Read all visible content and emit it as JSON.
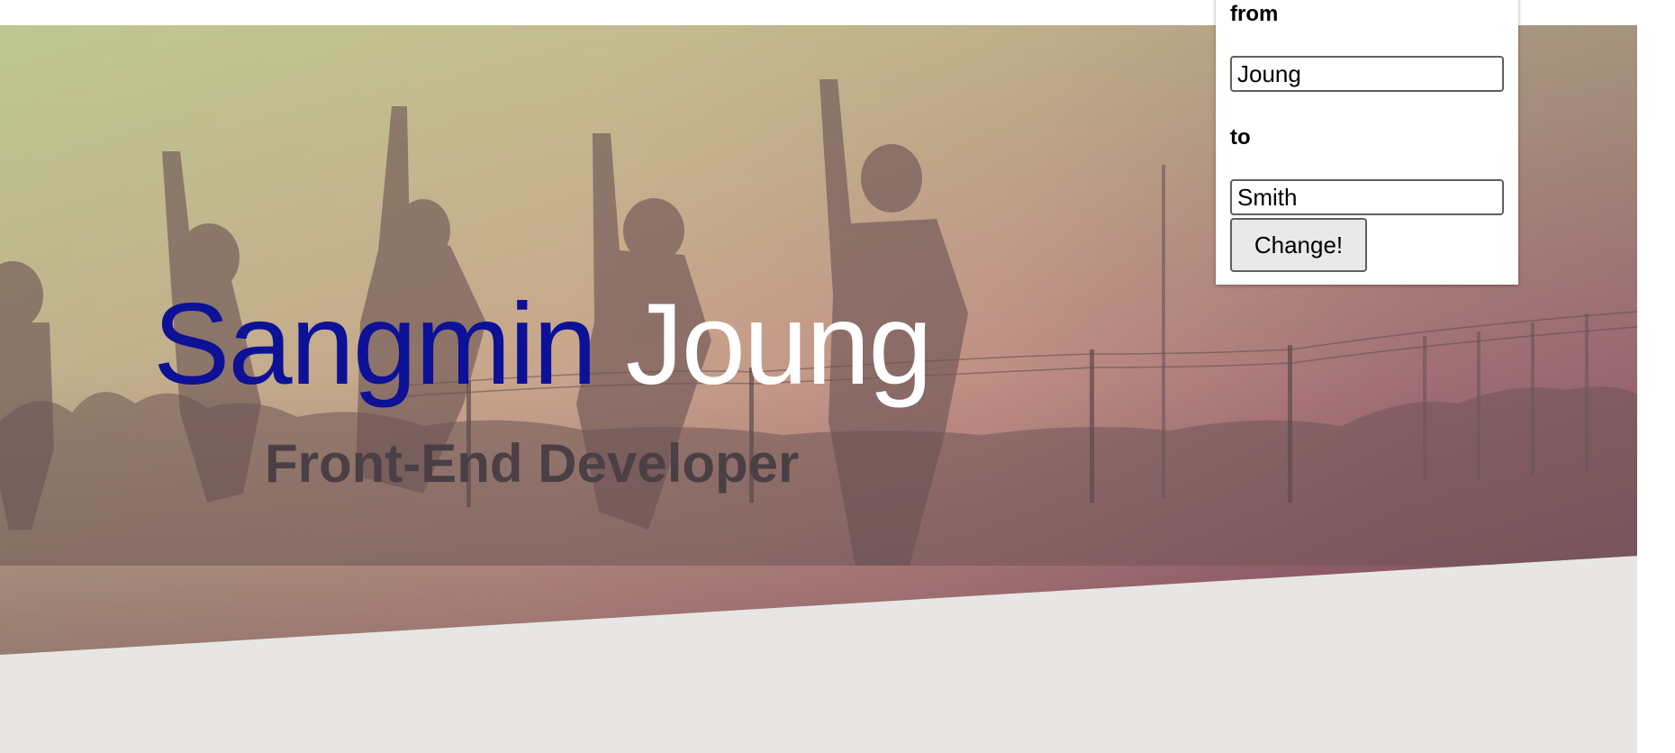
{
  "hero": {
    "first_name": "Sangmin",
    "last_name": "Joung",
    "subtitle": "Front-End Developer"
  },
  "change_form": {
    "from_label": "from",
    "from_value": "Joung",
    "to_label": "to",
    "to_value": "Smith",
    "button_label": "Change!"
  },
  "colors": {
    "first_name": "#0d1196",
    "last_name": "#ffffff",
    "subtitle": "#4a3f45",
    "page_background": "#e7e6e4"
  }
}
